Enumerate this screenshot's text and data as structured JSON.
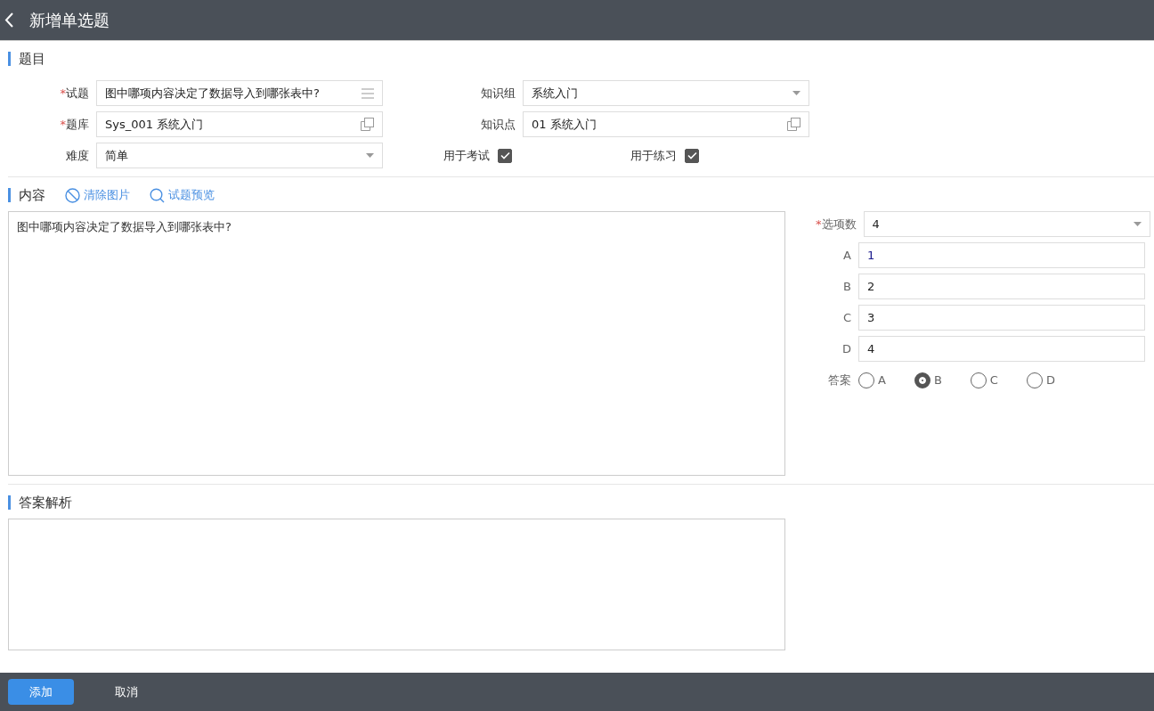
{
  "header": {
    "title": "新增单选题"
  },
  "question_section": {
    "title": "题目",
    "left_fields": [
      {
        "label": "试题",
        "marker": "*",
        "value": "图中哪项内容决定了数据导入到哪张表中?",
        "kind": "menu"
      },
      {
        "label": "题库",
        "marker": "*",
        "value": "Sys_001 系统入门",
        "kind": "picker"
      },
      {
        "label": "难度",
        "value": "简单",
        "kind": "dropdown"
      }
    ],
    "right_fields": [
      {
        "label": "知识组",
        "value": "系统入门",
        "kind": "dropdown"
      },
      {
        "label": "知识点",
        "value": "01 系统入门",
        "kind": "picker"
      }
    ],
    "checkboxes": [
      {
        "label": "用于考试",
        "checked": true
      },
      {
        "label": "用于练习",
        "checked": true
      }
    ]
  },
  "content_section": {
    "title": "内容",
    "actions": [
      "清除图片",
      "试题预览"
    ],
    "text": "图中哪项内容决定了数据导入到哪张表中?"
  },
  "options_panel": {
    "count_label": "选项数",
    "count_marker": "*",
    "count_value": "4",
    "options": [
      {
        "label": "A",
        "value": "1"
      },
      {
        "label": "B",
        "value": "2"
      },
      {
        "label": "C",
        "value": "3"
      },
      {
        "label": "D",
        "value": "4"
      }
    ],
    "answer_label": "答案",
    "answers": [
      {
        "label": "A",
        "selected": false
      },
      {
        "label": "B",
        "selected": true
      },
      {
        "label": "C",
        "selected": false
      },
      {
        "label": "D",
        "selected": false
      }
    ]
  },
  "analysis_section": {
    "title": "答案解析"
  },
  "footer": {
    "buttons": [
      "添加",
      "取消"
    ]
  }
}
